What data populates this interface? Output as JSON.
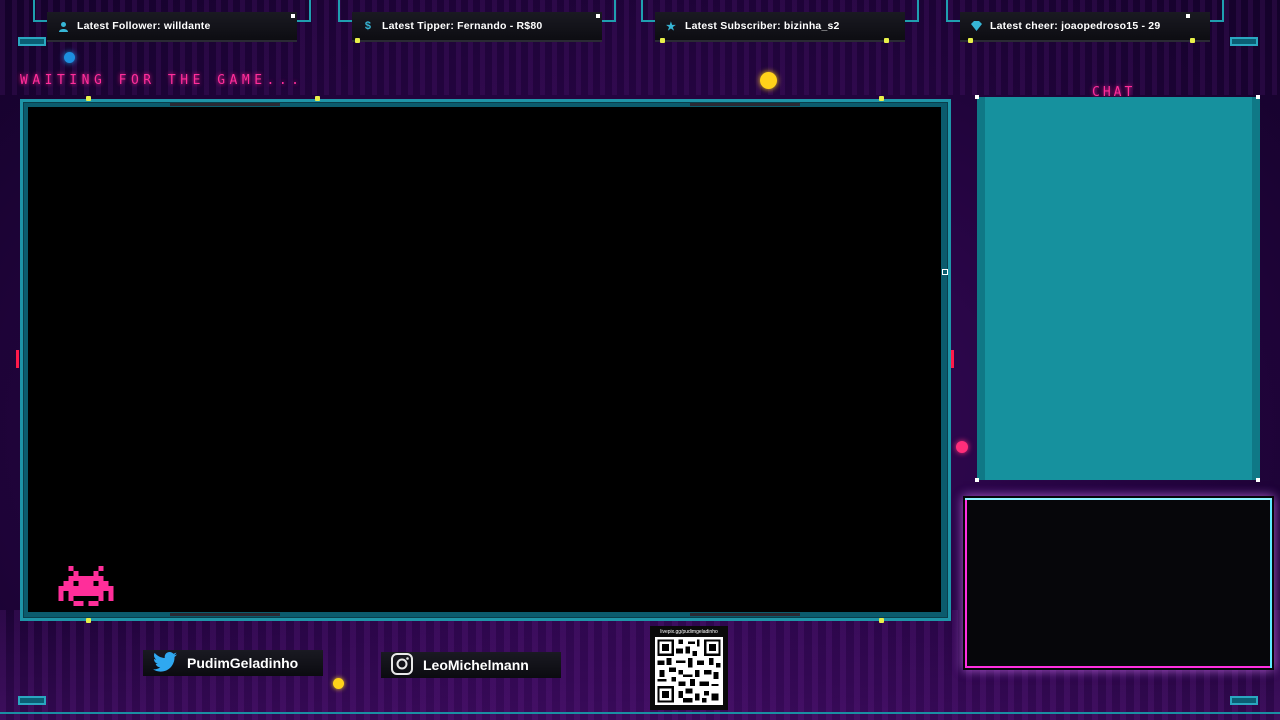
{
  "alerts": {
    "follower": {
      "label": "Latest Follower: willdante",
      "icon": "user-icon"
    },
    "tipper": {
      "label": "Latest Tipper: Fernando - R$80",
      "icon": "dollar-icon"
    },
    "subscriber": {
      "label": "Latest Subscriber: bizinha_s2",
      "icon": "star-icon"
    },
    "cheer": {
      "label": "Latest cheer: joaopedroso15 - 29",
      "icon": "diamond-icon"
    }
  },
  "status": {
    "waiting_text": "WAITING FOR THE GAME..."
  },
  "chat": {
    "title": "CHAT"
  },
  "socials": {
    "twitter": {
      "handle": "PudimGeladinho",
      "icon": "twitter-icon"
    },
    "instagram": {
      "handle": "LeoMichelmann",
      "icon": "instagram-icon"
    }
  },
  "qr": {
    "caption": "livepix.gg/pudimgeladinho"
  },
  "colors": {
    "accent_pink": "#ff2e9a",
    "accent_teal": "#1e95a8",
    "chat_bg": "#16919e",
    "dot_yellow": "#e8f04a"
  }
}
